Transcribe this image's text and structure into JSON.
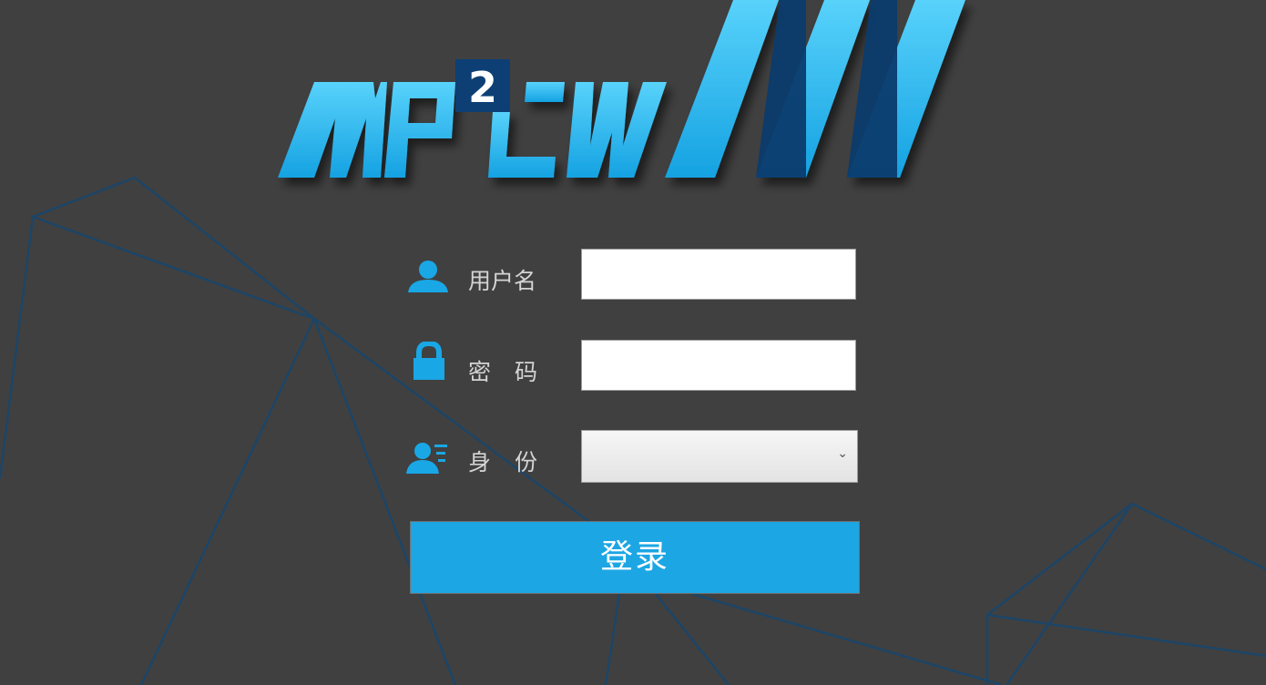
{
  "logo": {
    "text": "MP²CW",
    "colors": {
      "cyan": "#23b6ee",
      "light_cyan": "#5fd6fb",
      "navy": "#0d3f74"
    }
  },
  "form": {
    "username": {
      "icon": "user-icon",
      "label": "用户名",
      "value": ""
    },
    "password": {
      "icon": "lock-icon",
      "label": "密码",
      "value": ""
    },
    "role": {
      "icon": "id-card-icon",
      "label": "身份",
      "selected": ""
    },
    "login_button": "登录"
  },
  "colors": {
    "background": "#404040",
    "accent": "#1ca6e4",
    "bg_lines": "#1c4567",
    "label_text": "#d4d4d4"
  }
}
